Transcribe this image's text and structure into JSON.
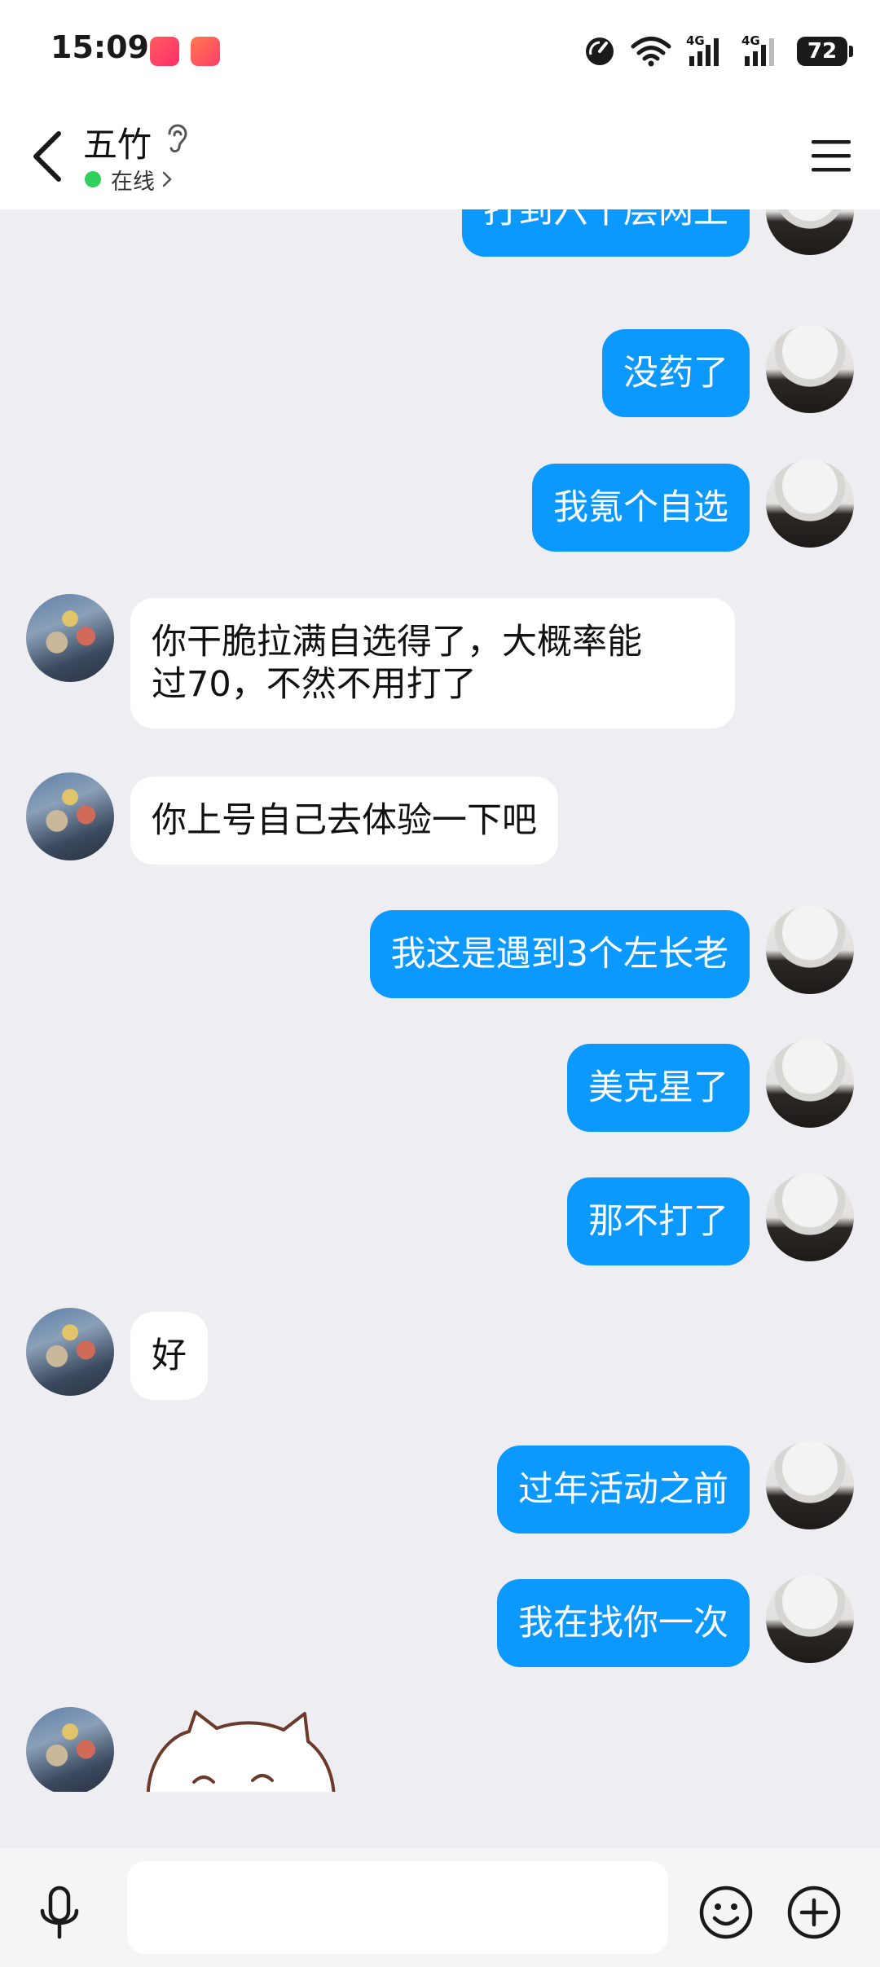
{
  "status_bar": {
    "time": "15:09",
    "network_1": "4G",
    "network_2": "4G",
    "battery": "72"
  },
  "header": {
    "contact_name": "五竹",
    "presence": "在线"
  },
  "messages": [
    {
      "from": "me",
      "text": "打到六十层网上"
    },
    {
      "from": "me",
      "text": "没药了"
    },
    {
      "from": "me",
      "text": "我氪个自选"
    },
    {
      "from": "other",
      "lines": [
        "你干脆拉满自选得了，大概率能",
        "过70，不然不用打了"
      ]
    },
    {
      "from": "other",
      "text": "你上号自己去体验一下吧"
    },
    {
      "from": "me",
      "text": "我这是遇到3个左长老"
    },
    {
      "from": "me",
      "text": "美克星了"
    },
    {
      "from": "me",
      "text": "那不打了"
    },
    {
      "from": "other",
      "text": "好"
    },
    {
      "from": "me",
      "text": "过年活动之前"
    },
    {
      "from": "me",
      "text": "我在找你一次"
    }
  ],
  "input": {
    "placeholder": ""
  },
  "colors": {
    "my_bubble": "#0b99ff",
    "other_bubble": "#ffffff",
    "background": "#eeeef2",
    "online": "#2fd15c"
  },
  "icons": [
    "back-icon",
    "ear-icon",
    "menu-icon",
    "voice-icon",
    "emoji-icon",
    "plus-icon",
    "wifi-icon",
    "signal-icon",
    "battery-icon",
    "data-saver-icon"
  ]
}
